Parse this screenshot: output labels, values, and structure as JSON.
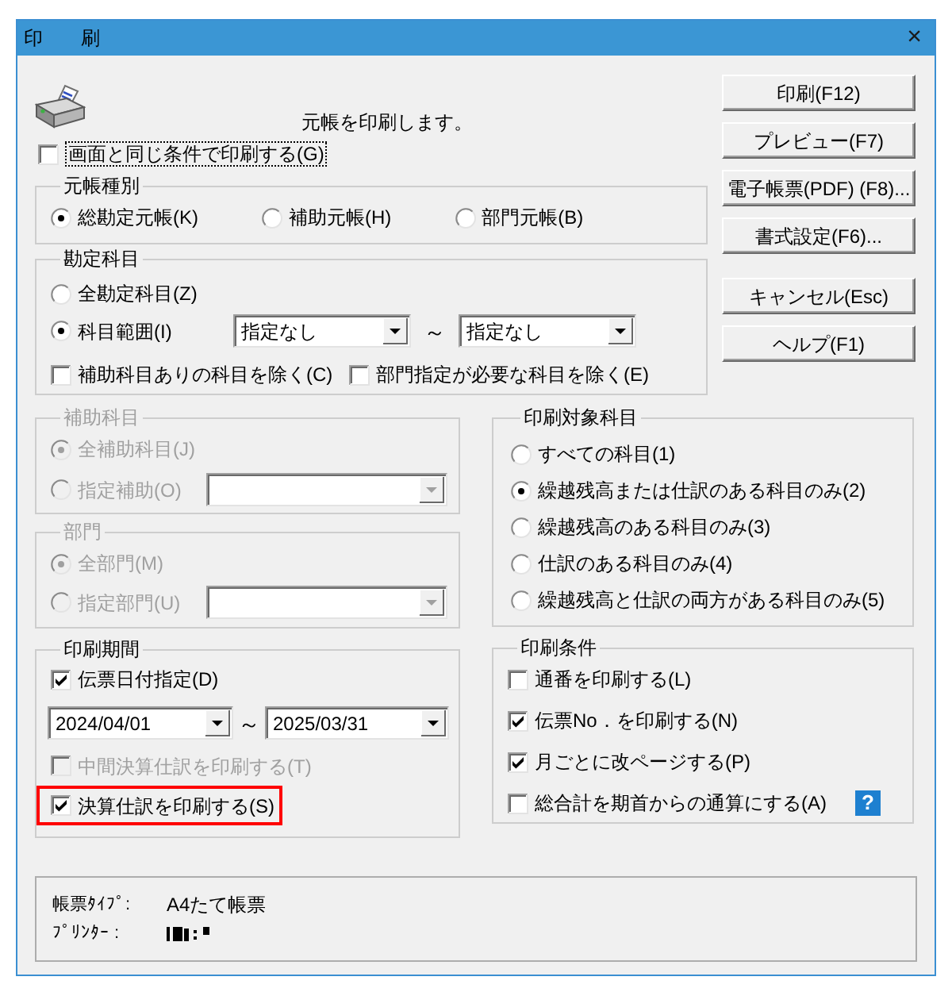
{
  "window": {
    "title": "印　　刷",
    "close": "×"
  },
  "header": {
    "message": "元帳を印刷します。"
  },
  "same_conditions": {
    "label": "画面と同じ条件で印刷する(G)",
    "checked": false,
    "focused": true
  },
  "ledger_type": {
    "title": "元帳種別",
    "options": [
      {
        "label": "総勘定元帳(K)",
        "selected": true
      },
      {
        "label": "補助元帳(H)",
        "selected": false
      },
      {
        "label": "部門元帳(B)",
        "selected": false
      }
    ]
  },
  "accounts": {
    "title": "勘定科目",
    "options": [
      {
        "label": "全勘定科目(Z)",
        "selected": false
      },
      {
        "label": "科目範囲(I)",
        "selected": true
      }
    ],
    "range_from": "指定なし",
    "range_separator": "～",
    "range_to": "指定なし",
    "excludes": [
      {
        "label": "補助科目ありの科目を除く(C)",
        "checked": false
      },
      {
        "label": "部門指定が必要な科目を除く(E)",
        "checked": false
      }
    ]
  },
  "action_buttons": [
    {
      "label": "印刷(F12)"
    },
    {
      "label": "プレビュー(F7)"
    },
    {
      "label": "電子帳票(PDF) (F8)..."
    },
    {
      "label": "書式設定(F6)..."
    }
  ],
  "dialog_buttons": [
    {
      "label": "キャンセル(Esc)"
    },
    {
      "label": "ヘルプ(F1)"
    }
  ],
  "sub_accounts": {
    "title": "補助科目",
    "disabled": true,
    "options": [
      {
        "label": "全補助科目(J)",
        "selected": true
      },
      {
        "label": "指定補助(O)",
        "selected": false
      }
    ]
  },
  "departments": {
    "title": "部門",
    "disabled": true,
    "options": [
      {
        "label": "全部門(M)",
        "selected": true
      },
      {
        "label": "指定部門(U)",
        "selected": false
      }
    ]
  },
  "print_period": {
    "title": "印刷期間",
    "date_filter": {
      "label": "伝票日付指定(D)",
      "checked": true
    },
    "date_from": "2024/04/01",
    "date_separator": "～",
    "date_to": "2025/03/31",
    "options": [
      {
        "label": "中間決算仕訳を印刷する(T)",
        "checked": false,
        "disabled": true,
        "highlighted": false
      },
      {
        "label": "決算仕訳を印刷する(S)",
        "checked": true,
        "disabled": false,
        "highlighted": true
      }
    ]
  },
  "target_accounts": {
    "title": "印刷対象科目",
    "options": [
      {
        "label": "すべての科目(1)",
        "selected": false
      },
      {
        "label": "繰越残高または仕訳のある科目のみ(2)",
        "selected": true
      },
      {
        "label": "繰越残高のある科目のみ(3)",
        "selected": false
      },
      {
        "label": "仕訳のある科目のみ(4)",
        "selected": false
      },
      {
        "label": "繰越残高と仕訳の両方がある科目のみ(5)",
        "selected": false
      }
    ]
  },
  "print_conditions": {
    "title": "印刷条件",
    "options": [
      {
        "label": "通番を印刷する(L)",
        "checked": false
      },
      {
        "label": "伝票No．を印刷する(N)",
        "checked": true
      },
      {
        "label": "月ごとに改ページする(P)",
        "checked": true
      },
      {
        "label": "総合計を期首からの通算にする(A)",
        "checked": false,
        "help": "?"
      }
    ]
  },
  "info": {
    "rows": [
      {
        "kind": "text",
        "label": "帳票ﾀｲﾌﾟ:",
        "value": "A4たて帳票"
      },
      {
        "kind": "redacted",
        "label": "ﾌﾟﾘﾝﾀｰ :"
      }
    ]
  }
}
